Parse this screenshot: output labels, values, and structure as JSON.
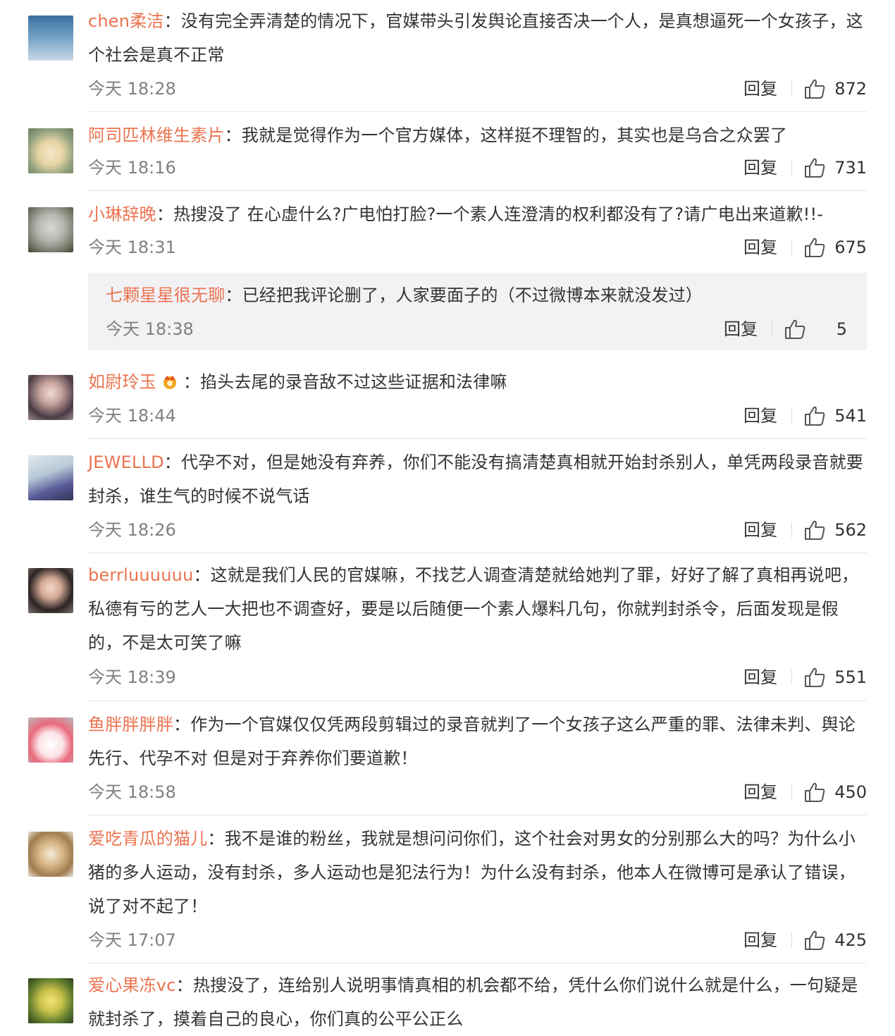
{
  "comments": [
    {
      "username": "chen柔洁",
      "text": "没有完全弄清楚的情况下，官媒带头引发舆论直接否决一个人，是真想逼死一个女孩子，这个社会是真不正常",
      "time": "今天 18:28",
      "reply_label": "回复",
      "likes": "872"
    },
    {
      "username": "阿司匹林维生素片",
      "text": "我就是觉得作为一个官方媒体，这样挺不理智的，其实也是乌合之众罢了",
      "time": "今天 18:16",
      "reply_label": "回复",
      "likes": "731"
    },
    {
      "username": "小琳辞晚",
      "text": "热搜没了 在心虚什么?广电怕打脸?一个素人连澄清的权利都没有了?请广电出来道歉!!-",
      "time": "今天 18:31",
      "reply_label": "回复",
      "likes": "675",
      "sub_reply": {
        "username": "七颗星星很无聊",
        "text": "已经把我评论删了，人家要面子的（不过微博本来就没发过）",
        "time": "今天 18:38",
        "reply_label": "回复",
        "likes": "5"
      }
    },
    {
      "username": "如尉玲玉",
      "text": "掐头去尾的录音敌不过这些证据和法律嘛",
      "time": "今天 18:44",
      "reply_label": "回复",
      "likes": "541"
    },
    {
      "username": "JEWELLD",
      "text": "代孕不对，但是她没有弃养，你们不能没有搞清楚真相就开始封杀别人，单凭两段录音就要封杀，谁生气的时候不说气话",
      "time": "今天 18:26",
      "reply_label": "回复",
      "likes": "562"
    },
    {
      "username": "berrluuuuuu",
      "text": "这就是我们人民的官媒嘛，不找艺人调查清楚就给她判了罪，好好了解了真相再说吧，私德有亏的艺人一大把也不调查好，要是以后随便一个素人爆料几句，你就判封杀令，后面发现是假的，不是太可笑了嘛",
      "time": "今天 18:39",
      "reply_label": "回复",
      "likes": "551"
    },
    {
      "username": "鱼胖胖胖胖",
      "text": "作为一个官媒仅仅凭两段剪辑过的录音就判了一个女孩子这么严重的罪、法律未判、舆论先行、代孕不对 但是对于弃养你们要道歉！",
      "time": "今天 18:58",
      "reply_label": "回复",
      "likes": "450"
    },
    {
      "username": "爱吃青瓜的猫儿",
      "text": "我不是谁的粉丝，我就是想问问你们，这个社会对男女的分别那么大的吗？为什么小猪的多人运动，没有封杀，多人运动也是犯法行为！为什么没有封杀，他本人在微博可是承认了错误，说了对不起了！",
      "time": "今天 17:07",
      "reply_label": "回复",
      "likes": "425"
    },
    {
      "username": "爱心果冻vc",
      "text": "热搜没了，连给别人说明事情真相的机会都不给，凭什么你们说什么就是什么，一句疑是就封杀了，摸着自己的良心，你们真的公平公正么",
      "time": "",
      "reply_label": "",
      "likes": ""
    }
  ],
  "colors": {
    "username": "#eb7350",
    "text": "#333333",
    "time": "#808080",
    "divider": "#e6e6e6",
    "subreply_bg": "#f2f2f5"
  }
}
